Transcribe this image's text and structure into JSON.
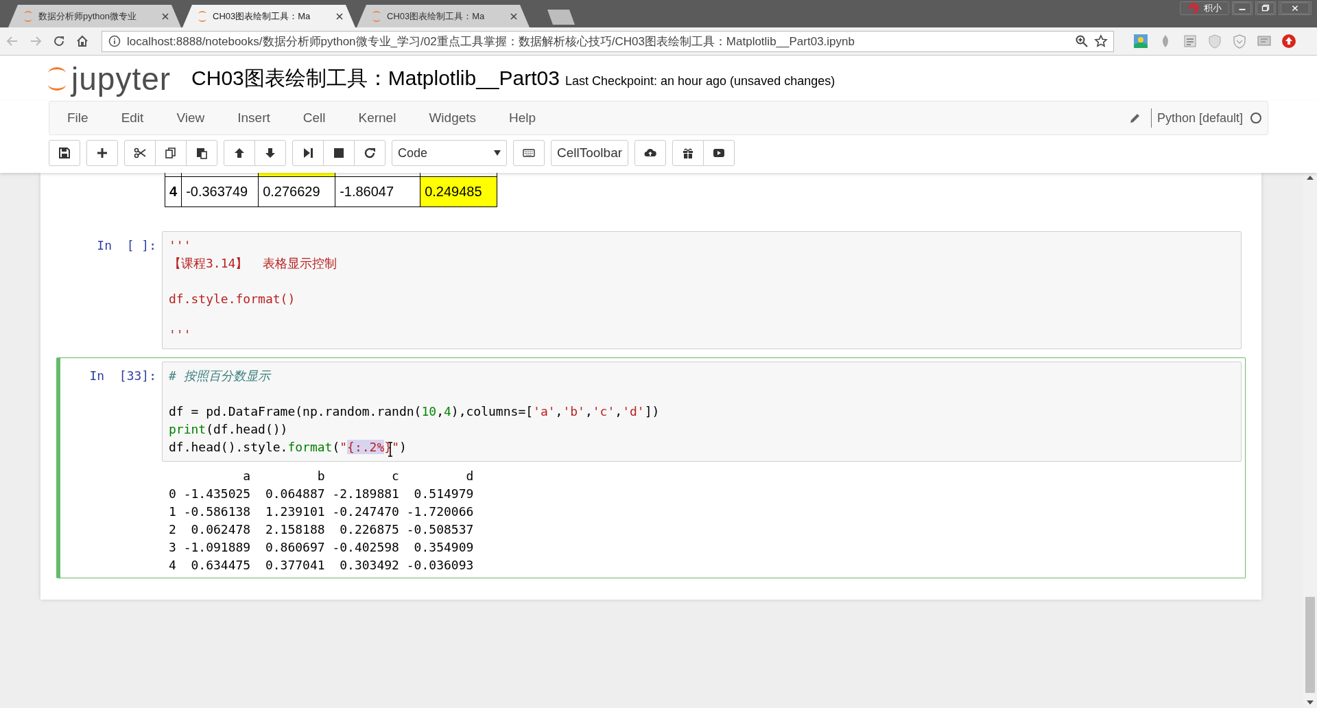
{
  "title_bar": {
    "extension_button": {
      "label": "积小"
    }
  },
  "browser_tabs": [
    {
      "title": "数据分析师python微专业",
      "selected": false
    },
    {
      "title": "CH03图表绘制工具：Ma",
      "selected": true
    },
    {
      "title": "CH03图表绘制工具：Ma",
      "selected": false
    }
  ],
  "address_bar": {
    "url": "localhost:8888/notebooks/数据分析师python微专业_学习/02重点工具掌握：数据解析核心技巧/CH03图表绘制工具：Matplotlib__Part03.ipynb"
  },
  "header": {
    "logo_text": "jupyter",
    "notebook_title": "CH03图表绘制工具：Matplotlib__Part03",
    "checkpoint": "Last Checkpoint: an hour ago (unsaved changes)"
  },
  "menu": [
    "File",
    "Edit",
    "View",
    "Insert",
    "Cell",
    "Kernel",
    "Widgets",
    "Help"
  ],
  "kernel": {
    "name": "Python [default]",
    "busy": false
  },
  "toolbar": {
    "cell_type": "Code",
    "celltoolbar_label": "CellToolbar"
  },
  "output_table": {
    "clipped_row": {
      "cells": [
        {
          "highlighted": false
        },
        {
          "highlighted": false
        },
        {
          "highlighted": true
        },
        {
          "highlighted": false
        },
        {
          "highlighted": false
        }
      ]
    },
    "rows": [
      {
        "cells": [
          {
            "text": "4",
            "highlighted": false
          },
          {
            "text": "-0.363749",
            "highlighted": false
          },
          {
            "text": "0.276629",
            "highlighted": false
          },
          {
            "text": "-1.86047",
            "highlighted": false
          },
          {
            "text": "0.249485",
            "highlighted": true
          }
        ]
      }
    ]
  },
  "cells": [
    {
      "prompt": "In  [ ]:",
      "selected": false,
      "source": [
        {
          "kind": "string",
          "text": "'''\n【课程3.14】  表格显示控制\n\ndf.style.format()\n\n'''"
        }
      ]
    },
    {
      "prompt": "In  [33]:",
      "selected": true,
      "source": [
        {
          "kind": "comment",
          "text": "# 按照百分数显示"
        },
        {
          "kind": "plain",
          "text": "\n\ndf = pd.DataFrame(np.random.randn("
        },
        {
          "kind": "number",
          "text": "10"
        },
        {
          "kind": "plain",
          "text": ","
        },
        {
          "kind": "number",
          "text": "4"
        },
        {
          "kind": "plain",
          "text": "),columns=["
        },
        {
          "kind": "string",
          "text": "'a'"
        },
        {
          "kind": "plain",
          "text": ","
        },
        {
          "kind": "string",
          "text": "'b'"
        },
        {
          "kind": "plain",
          "text": ","
        },
        {
          "kind": "string",
          "text": "'c'"
        },
        {
          "kind": "plain",
          "text": ","
        },
        {
          "kind": "string",
          "text": "'d'"
        },
        {
          "kind": "plain",
          "text": "])\n"
        },
        {
          "kind": "builtin",
          "text": "print"
        },
        {
          "kind": "plain",
          "text": "(df.head())\ndf.head().style."
        },
        {
          "kind": "builtin",
          "text": "format"
        },
        {
          "kind": "plain",
          "text": "("
        },
        {
          "kind": "string",
          "text": "\""
        },
        {
          "kind": "selected-string",
          "text": "{:.2%",
          "pointer_after": true
        },
        {
          "kind": "string",
          "text": "}\""
        },
        {
          "kind": "plain",
          "text": ")"
        }
      ],
      "output": [
        "          a         b         c         d",
        "0 -1.435025  0.064887 -2.189881  0.514979",
        "1 -0.586138  1.239101 -0.247470 -1.720066",
        "2  0.062478  2.158188  0.226875 -0.508537",
        "3 -1.091889  0.860697 -0.402598  0.354909",
        "4  0.634475  0.377041  0.303492 -0.036093"
      ]
    }
  ]
}
